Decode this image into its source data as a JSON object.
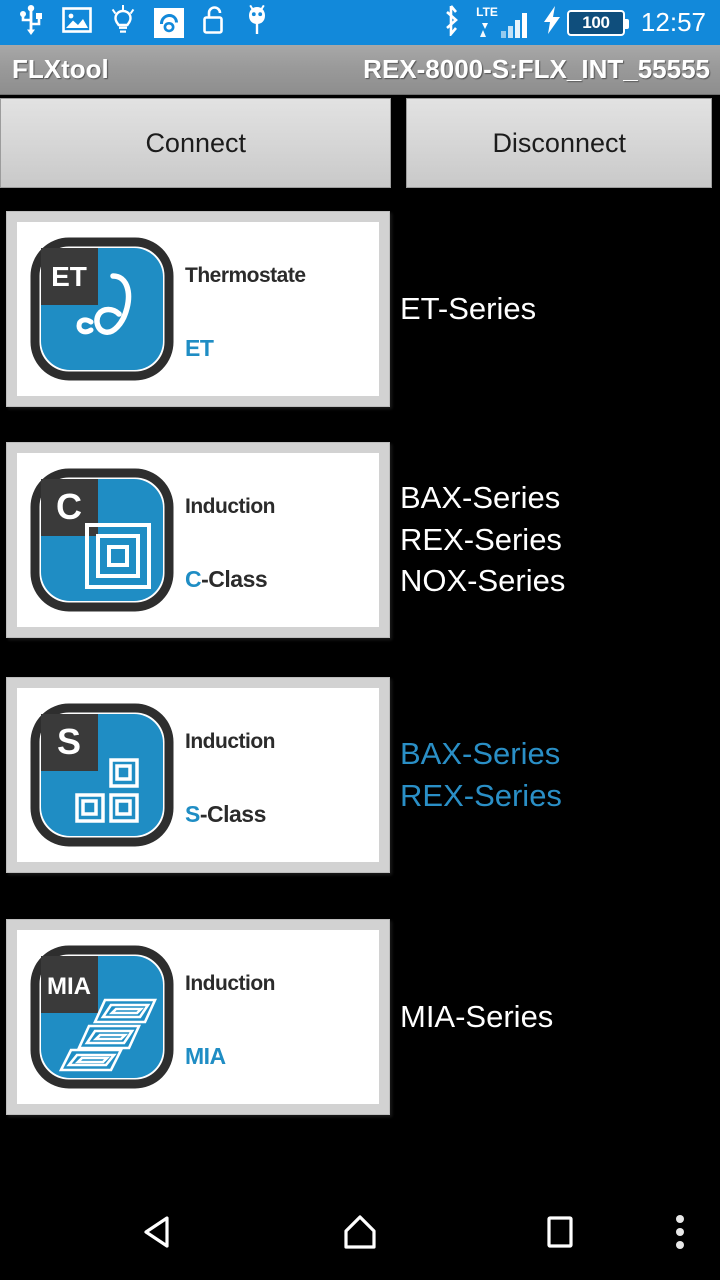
{
  "statusbar": {
    "icons": [
      {
        "name": "usb-icon",
        "label": "USB"
      },
      {
        "name": "screenshot-image-icon",
        "label": "Screenshot"
      },
      {
        "name": "flashlight-bulb-icon",
        "label": "Flashlight"
      },
      {
        "name": "avira-antivirus-icon",
        "label": "Avira"
      },
      {
        "name": "unlocked-padlock-icon",
        "label": "Unlocked"
      },
      {
        "name": "android-debug-icon",
        "label": "Android"
      }
    ],
    "bluetooth_icon": "bluetooth-icon",
    "network_type": "LTE",
    "signal_icon": "signal-bars-icon",
    "charging_icon": "charging-bolt-icon",
    "battery_level": "100",
    "time": "12:57"
  },
  "titlebar": {
    "app_title": "FLXtool",
    "device_id": "REX-8000-S:FLX_INT_55555"
  },
  "toolbar": {
    "connect_label": "Connect",
    "disconnect_label": "Disconnect"
  },
  "colors": {
    "statusbar_blue": "#1289da",
    "logo_blue": "#1f8dc4",
    "highlight_blue": "#2a8fc6",
    "badge_dark": "#3a3a3a",
    "text_white": "#ffffff"
  },
  "list": [
    {
      "logo": {
        "badge": "ET",
        "glyph_name": "theta-temperature-icon",
        "category": "Thermostate",
        "model_accent": "ET",
        "model_rest": ""
      },
      "series": [
        "ET-Series"
      ],
      "highlighted": false
    },
    {
      "logo": {
        "badge": "C",
        "glyph_name": "concentric-squares-icon",
        "category": "Induction",
        "model_accent": "C",
        "model_rest": "-Class"
      },
      "series": [
        "BAX-Series",
        "REX-Series",
        "NOX-Series"
      ],
      "highlighted": false
    },
    {
      "logo": {
        "badge": "S",
        "glyph_name": "three-squares-icon",
        "category": "Induction",
        "model_accent": "S",
        "model_rest": "-Class"
      },
      "series": [
        "BAX-Series",
        "REX-Series"
      ],
      "highlighted": true
    },
    {
      "logo": {
        "badge": "MIA",
        "glyph_name": "induction-coils-icon",
        "category": "Induction",
        "model_accent": "MIA",
        "model_rest": ""
      },
      "series": [
        "MIA-Series"
      ],
      "highlighted": false
    }
  ],
  "navbar": {
    "back_label": "Back",
    "home_label": "Home",
    "recents_label": "Recents",
    "more_label": "More options"
  }
}
